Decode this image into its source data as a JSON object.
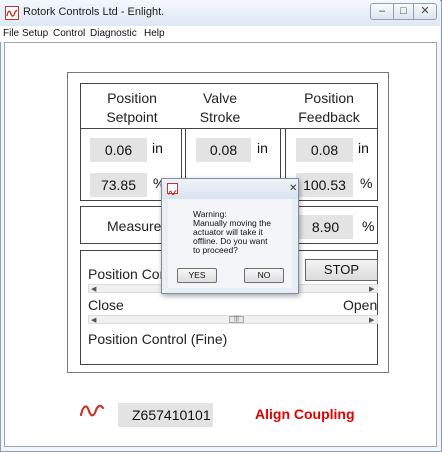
{
  "window": {
    "title": "Rotork Controls Ltd - Enlight."
  },
  "menu": [
    "File",
    "Setup",
    "Control",
    "Diagnostic",
    "Help"
  ],
  "headers": {
    "setpoint": [
      "Position",
      "Setpoint"
    ],
    "stroke": [
      "Valve",
      "Stroke"
    ],
    "feedback": [
      "Position",
      "Feedback"
    ]
  },
  "setpoint": {
    "in_value": "0.06",
    "in_unit": "in",
    "pct_value": "73.85",
    "pct_unit": "%"
  },
  "stroke": {
    "in_value": "0.08",
    "in_unit": "in"
  },
  "feedback": {
    "in_value": "0.08",
    "in_unit": "in",
    "pct_value": "100.53",
    "pct_unit": "%"
  },
  "measured": {
    "label": "Measured",
    "value": "8.90",
    "unit": "%"
  },
  "position_control": {
    "label": "Position Con",
    "stop_label": "STOP",
    "close_label": "Close",
    "open_label": "Open",
    "fine_label": "Position Control (Fine)"
  },
  "footer": {
    "serial": "Z657410101",
    "status": "Align Coupling"
  },
  "dialog": {
    "lines": [
      "Warning:",
      "Manually moving the",
      "actuator will take it",
      "offline. Do you want",
      "to proceed?"
    ],
    "yes": "YES",
    "no": "NO"
  },
  "colors": {
    "status": "#e00000",
    "accent": "#c0392b"
  }
}
